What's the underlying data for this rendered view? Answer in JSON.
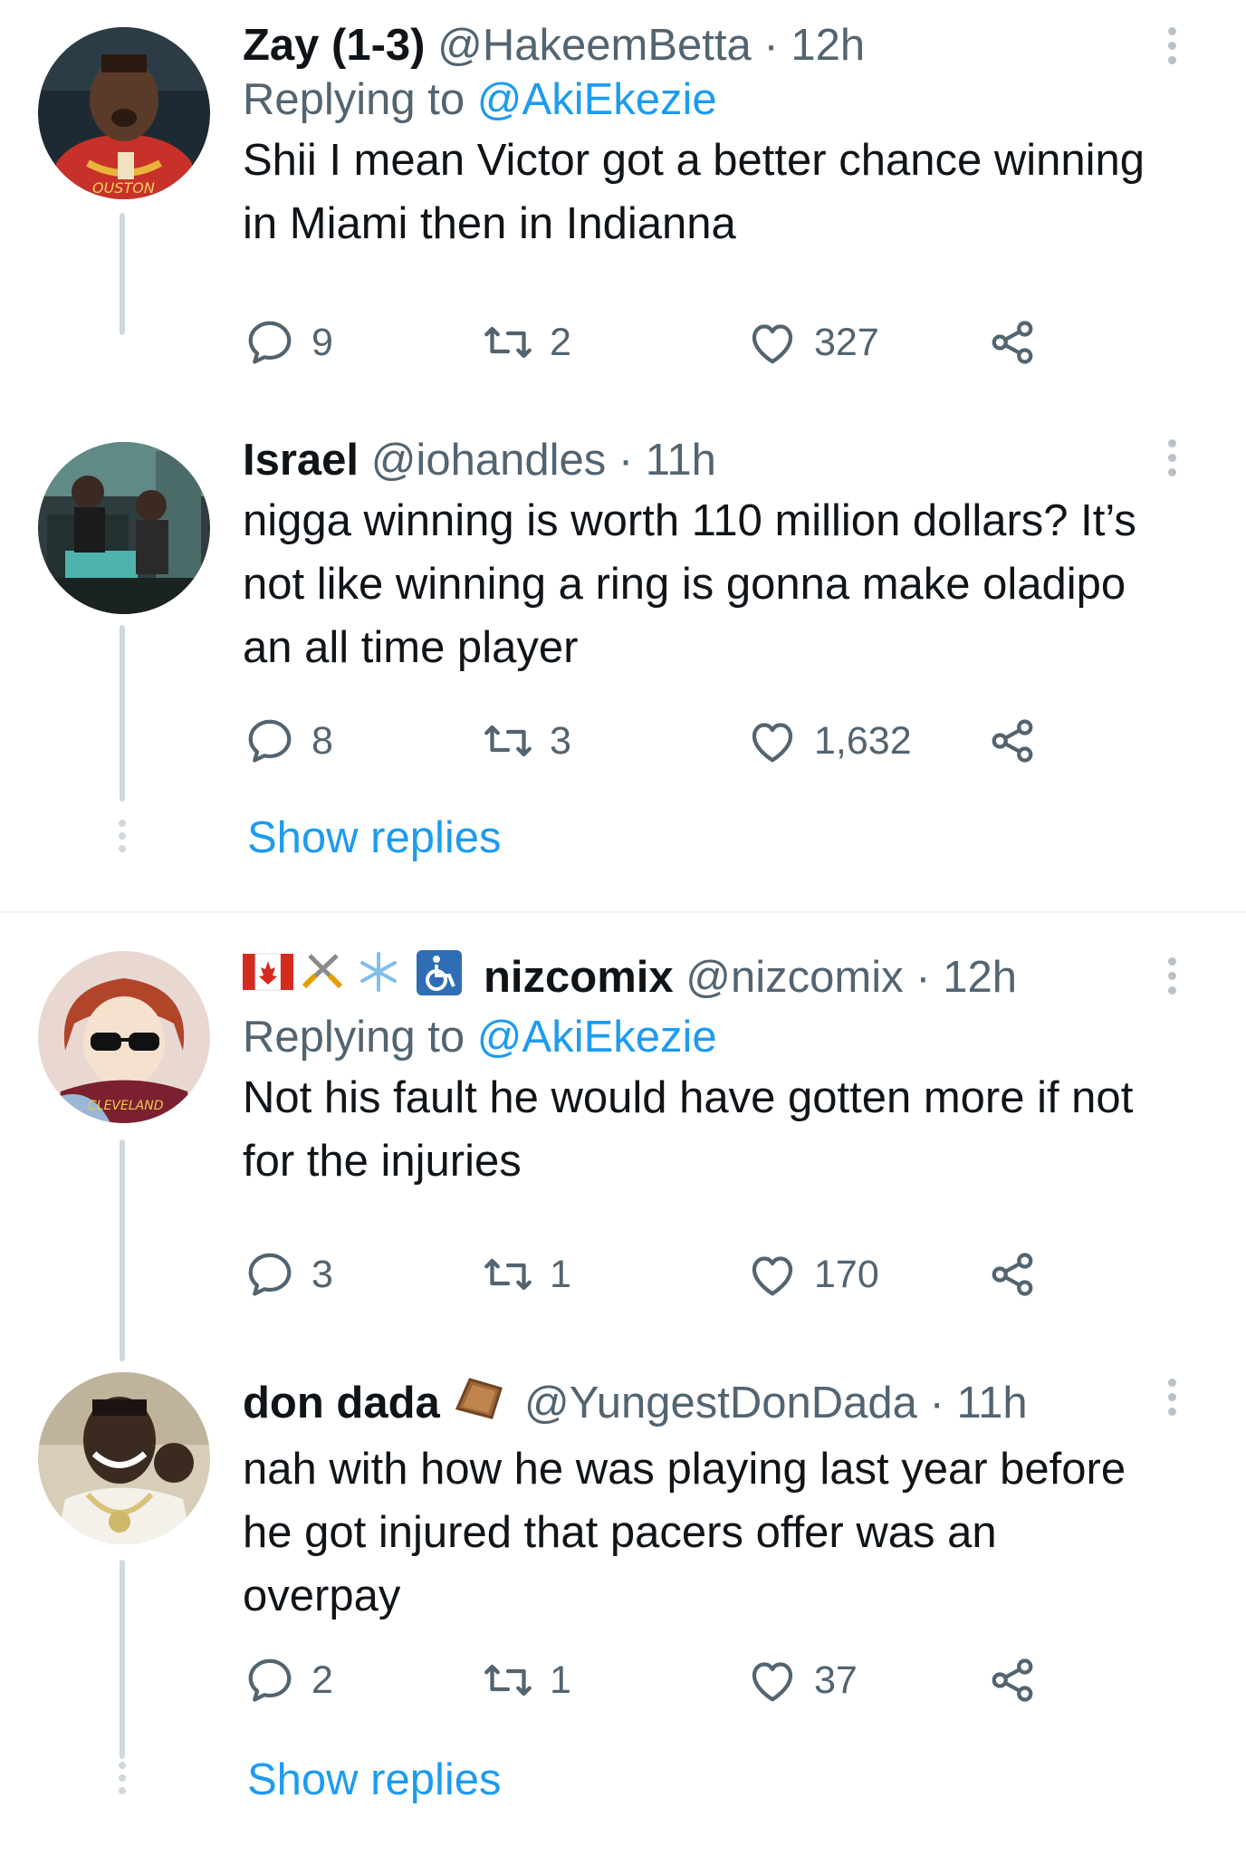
{
  "tweets": [
    {
      "name": "Zay (1-3)",
      "handle": "@HakeemBetta",
      "time": "· 12h",
      "replying_prefix": "Replying to ",
      "replying_to": "@AkiEkezie",
      "text_lines": [
        "Shii I mean Victor got a better chance winning",
        "in Miami then in Indianna"
      ],
      "replies": "9",
      "retweets": "2",
      "likes": "327"
    },
    {
      "name": "Israel",
      "handle": "@iohandles",
      "time": "· 11h",
      "text_lines": [
        "nigga winning is worth 110 million dollars? It’s",
        "not like winning a ring is gonna make oladipo",
        "an all time player"
      ],
      "replies": "8",
      "retweets": "3",
      "likes": "1,632"
    },
    {
      "name_emoji": "🇨🇦⚔️❄️♿",
      "name": "nizcomix",
      "handle": "@nizcomix",
      "time": "· 12h",
      "replying_prefix": "Replying to ",
      "replying_to": "@AkiEkezie",
      "text_lines": [
        "Not his fault he would have gotten more if not",
        "for the injuries"
      ],
      "replies": "3",
      "retweets": "1",
      "likes": "170"
    },
    {
      "name": "don dada",
      "name_emoji": "⚰️",
      "handle": "@YungestDonDada",
      "time": "· 11h",
      "text_lines": [
        "nah with how he was playing last year before",
        "he got injured that pacers offer was an",
        "overpay"
      ],
      "replies": "2",
      "retweets": "1",
      "likes": "37"
    }
  ],
  "show_replies_label": "Show replies",
  "colors": {
    "link": "#1d9bf0",
    "secondary_text": "#536471",
    "thread_line": "#cfd9de",
    "icon": "#536471"
  },
  "icons": {
    "reply": "reply-icon",
    "retweet": "retweet-icon",
    "like": "heart-icon",
    "share": "share-icon",
    "more": "more-icon"
  }
}
